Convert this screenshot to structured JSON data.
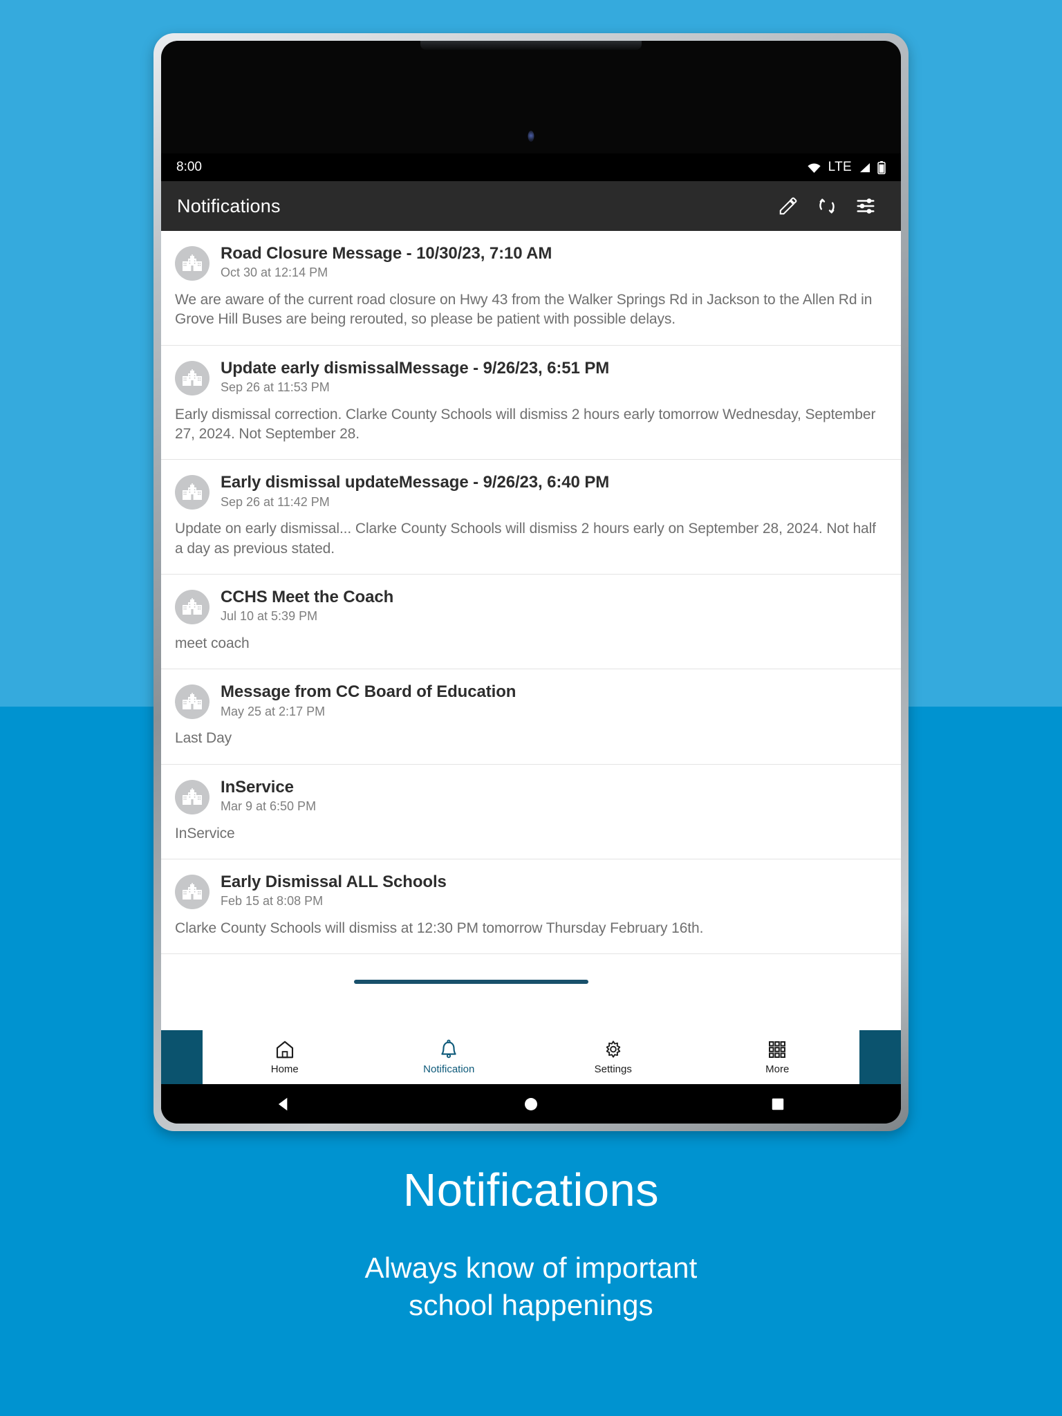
{
  "background": {
    "top_color": "#35aadd",
    "bottom_color": "#0093d0"
  },
  "statusbar": {
    "time": "8:00",
    "network_label": "LTE",
    "icons": [
      "wifi-icon",
      "signal-icon",
      "battery-icon"
    ]
  },
  "appbar": {
    "title": "Notifications",
    "actions": [
      {
        "name": "edit-icon",
        "label": "Edit"
      },
      {
        "name": "refresh-icon",
        "label": "Refresh"
      },
      {
        "name": "filter-icon",
        "label": "Filter"
      }
    ]
  },
  "notifications": [
    {
      "title": "Road Closure Message - 10/30/23, 7:10 AM",
      "date": "Oct 30 at 12:14 PM",
      "body": "We are aware of the current road closure on Hwy 43 from the Walker Springs Rd in Jackson to the Allen Rd in Grove Hill  Buses are being rerouted, so please be patient with possible delays."
    },
    {
      "title": "Update early dismissalMessage - 9/26/23, 6:51 PM",
      "date": "Sep 26 at 11:53 PM",
      "body": "Early dismissal correction. Clarke County Schools will dismiss 2 hours early tomorrow Wednesday, September 27, 2024. Not September 28."
    },
    {
      "title": "Early dismissal updateMessage - 9/26/23, 6:40 PM",
      "date": "Sep 26 at 11:42 PM",
      "body": "Update on early dismissal... Clarke County Schools will dismiss 2 hours early on September 28, 2024. Not half a day as previous stated."
    },
    {
      "title": "CCHS Meet the Coach",
      "date": "Jul 10 at 5:39 PM",
      "body": "meet coach"
    },
    {
      "title": "Message from CC Board of Education",
      "date": "May 25 at 2:17 PM",
      "body": "Last Day"
    },
    {
      "title": "InService",
      "date": "Mar 9 at 6:50 PM",
      "body": "InService"
    },
    {
      "title": "Early Dismissal ALL Schools",
      "date": "Feb 15 at 8:08 PM",
      "body": "Clarke County Schools will dismiss at 12:30 PM  tomorrow  Thursday February 16th."
    }
  ],
  "bottom_nav": {
    "active_color": "#0e5a7a",
    "surround_color": "#0b536e",
    "items": [
      {
        "icon": "home-icon",
        "label": "Home",
        "active": false
      },
      {
        "icon": "bell-icon",
        "label": "Notification",
        "active": true
      },
      {
        "icon": "gear-icon",
        "label": "Settings",
        "active": false
      },
      {
        "icon": "grid-icon",
        "label": "More",
        "active": false
      }
    ]
  },
  "system_nav": {
    "buttons": [
      "back-icon",
      "home-circle-icon",
      "recents-square-icon"
    ]
  },
  "caption": {
    "title": "Notifications",
    "subtitle_line1": "Always know of important",
    "subtitle_line2": "school happenings"
  }
}
